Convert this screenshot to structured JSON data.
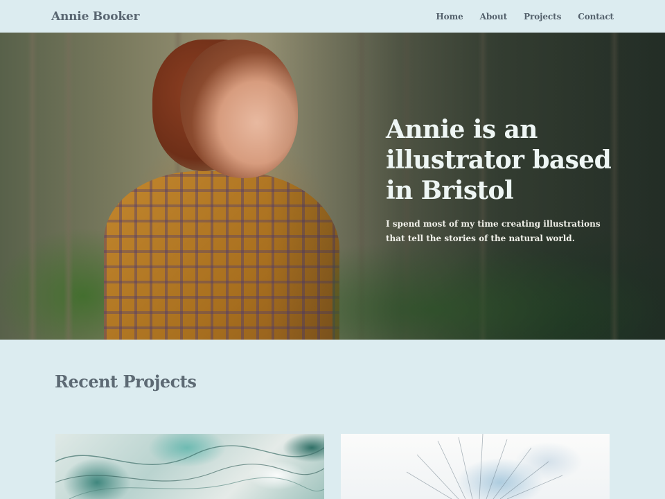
{
  "header": {
    "brand": "Annie Booker",
    "nav": [
      "Home",
      "About",
      "Projects",
      "Contact"
    ]
  },
  "hero": {
    "title_lines": [
      "Annie is an",
      "illustrator based",
      "in Bristol"
    ],
    "subtitle": "I spend most of my time creating illustrations that tell the stories of the natural world."
  },
  "projects": {
    "heading": "Recent Projects"
  },
  "colors": {
    "page_background": "#dcecf0",
    "text_muted": "#5a6772",
    "hero_text": "#eef6f4"
  }
}
